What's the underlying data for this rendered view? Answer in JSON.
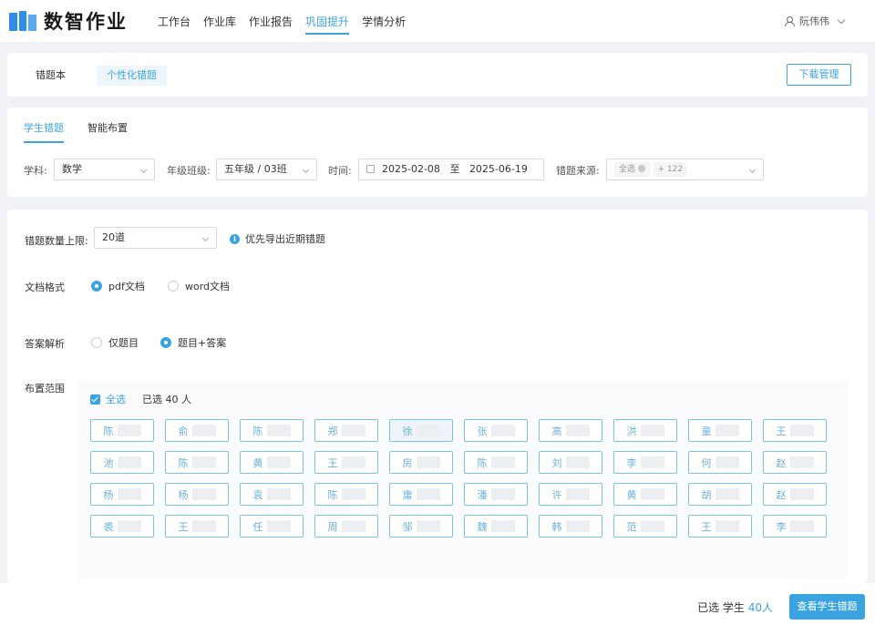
{
  "brand": {
    "name": "数智作业",
    "color": "#2f8fe6"
  },
  "accent": "#3ba4e0",
  "nav": [
    "工作台",
    "作业库",
    "作业报告",
    "巩固提升",
    "学情分析"
  ],
  "nav_active": 3,
  "user": {
    "name": "阮伟伟",
    "icon": "user-icon"
  },
  "subtabs": {
    "wrong_book": "错题本",
    "personalized": "个性化错题"
  },
  "download_button": "下载管理",
  "filter_tabs": {
    "student_wrong": "学生错题",
    "smart_assign": "智能布置"
  },
  "filters": {
    "subject_label": "学科:",
    "subject_value": "数学",
    "class_label": "年级班级:",
    "class_value": "五年级 / 03班",
    "time_label": "时间:",
    "date_start": "2025-02-08",
    "date_sep": "至",
    "date_end": "2025-06-19",
    "source_label": "错题来源:",
    "source_tag": "全选",
    "source_more": "+ 122"
  },
  "limit": {
    "label": "错题数量上限:",
    "value": "20道",
    "tip": "优先导出近期错题"
  },
  "doc_format": {
    "label": "文档格式",
    "options": [
      "pdf文档",
      "word文档"
    ],
    "selected": 0
  },
  "answer": {
    "label": "答案解析",
    "options": [
      "仅题目",
      "题目+答案"
    ],
    "selected": 1
  },
  "scope": {
    "label": "布置范围",
    "select_all": "全选",
    "selected_count": "已选 40 人",
    "students": [
      "陈",
      "俞",
      "陈",
      "郑",
      "徐",
      "张",
      "高",
      "洪",
      "童",
      "王",
      "池",
      "陈",
      "黄",
      "王",
      "房",
      "陈",
      "刘",
      "李",
      "何",
      "赵",
      "杨",
      "杨",
      "袁",
      "陈",
      "庸",
      "潘",
      "许",
      "黄",
      "胡",
      "赵",
      "裘",
      "王",
      "任",
      "周",
      "邹",
      "魏",
      "韩",
      "范",
      "王",
      "李"
    ]
  },
  "footer": {
    "prefix": "已选 学生",
    "count": "40人",
    "button": "查看学生错题"
  }
}
